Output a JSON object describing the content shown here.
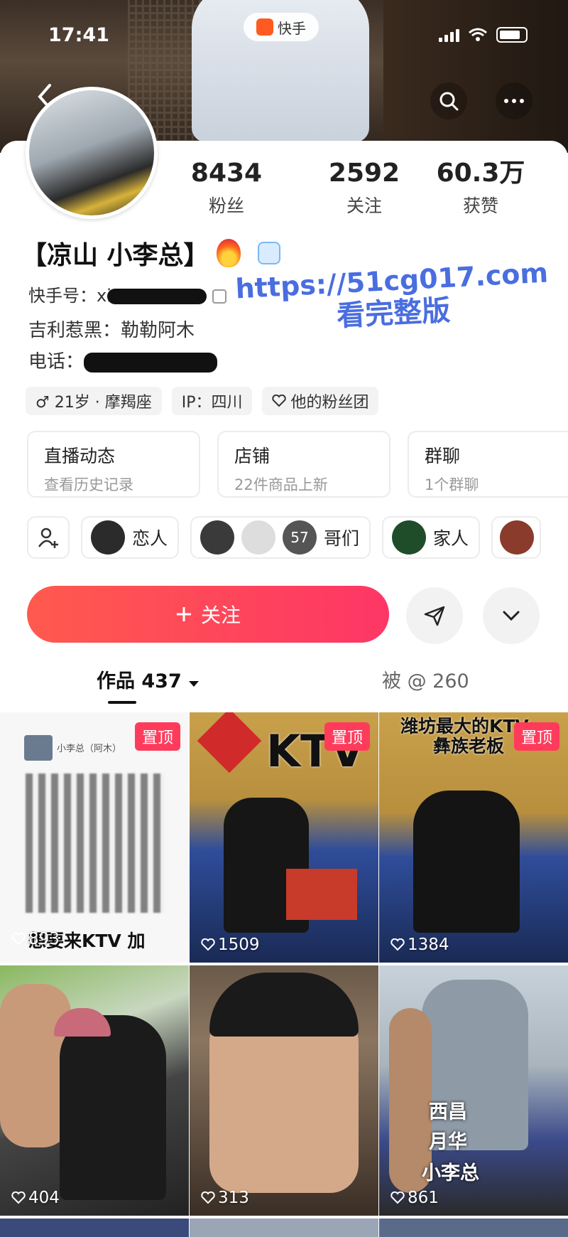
{
  "status_bar": {
    "time": "17:41"
  },
  "app_badge": {
    "label": "快手"
  },
  "profile": {
    "nickname": "【凉山 小李总】",
    "stats": [
      {
        "value": "8434",
        "label": "粉丝"
      },
      {
        "value": "2592",
        "label": "关注"
      },
      {
        "value": "60.3万",
        "label": "获赞"
      }
    ],
    "kuaishou_id_label": "快手号：",
    "kuaishou_id_visible": "xi",
    "bio_line": "吉利惹黑：勒勒阿木",
    "phone_label": "电话：",
    "tags": [
      "♂ 21岁 · 摩羯座",
      "IP：四川",
      "他的粉丝团"
    ]
  },
  "watermark": {
    "line1": "https://51cg017.com",
    "line2": "看完整版"
  },
  "cards": [
    {
      "title": "直播动态",
      "subtitle": "查看历史记录"
    },
    {
      "title": "店铺",
      "subtitle": "22件商品上新"
    },
    {
      "title": "群聊",
      "subtitle": "1个群聊"
    }
  ],
  "groups": [
    {
      "label": "恋人"
    },
    {
      "label": "哥们",
      "badge": "57"
    },
    {
      "label": "家人"
    }
  ],
  "follow_button": {
    "label": "关注"
  },
  "tabs": {
    "works": "作品 437",
    "mentioned": "被 @ 260"
  },
  "videos": [
    {
      "likes": "893",
      "pinned": "置顶",
      "caption": "想要来KTV 加",
      "author": "小李总（阿木）"
    },
    {
      "likes": "1509",
      "pinned": "置顶",
      "caption": "KTV"
    },
    {
      "likes": "1384",
      "pinned": "置顶",
      "caption": "潍坊最大的KTV",
      "caption2": "彝族老板"
    },
    {
      "likes": "404"
    },
    {
      "likes": "313"
    },
    {
      "likes": "861",
      "caption": "西昌",
      "caption2": "月华",
      "caption3": "小李总"
    }
  ],
  "colors": {
    "follow": "#fe3666",
    "pin": "#ff3b5c",
    "watermark": "#4a6ee0"
  }
}
